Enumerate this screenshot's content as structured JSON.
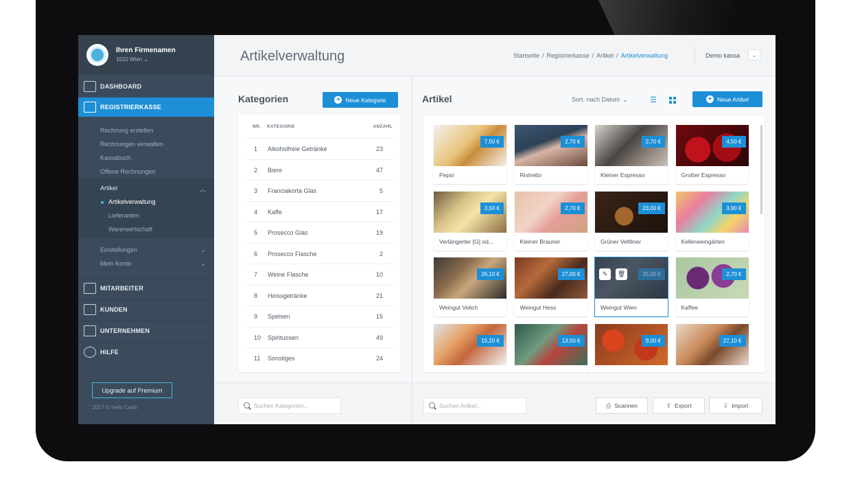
{
  "sidebar": {
    "company": "Ihren Firmenamen",
    "city": "1010 Wien",
    "main": {
      "dashboard": "DASHBOARD",
      "registrierkasse": "REGISTRIERKASSE",
      "mitarbeiter": "MITARBEITER",
      "kunden": "KUNDEN",
      "unternehmen": "UNTERNEHMEN",
      "hilfe": "HILFE"
    },
    "sub": [
      "Rechnung erstellen",
      "Rechnungen verwalten",
      "Kassabuch",
      "Offene Rechnungen"
    ],
    "artikel": "Artikel",
    "artikel_sub": [
      "Artikelverwaltung",
      "Lieferanten",
      "Warenwirtschaft"
    ],
    "einstellungen": "Einstellungen",
    "mein_konto": "Mein Konto",
    "upgrade": "Upgrade auf Premium",
    "copyright": "2017 © hello Cash"
  },
  "header": {
    "title": "Artikelverwaltung",
    "breadcrumb": [
      "Startseite",
      "/",
      "Registrierkasse",
      "/",
      "Artikel",
      "/",
      "Artikelverwaltung"
    ],
    "account": "Demo kassa"
  },
  "categories": {
    "title": "Kategorien",
    "new_button": "Neue Kategorie",
    "col_nr": "NR.",
    "col_name": "KATEGORIE",
    "col_count": "ANZAHL",
    "rows": [
      {
        "nr": "1",
        "name": "Alkoholfreie Getränke",
        "count": "23"
      },
      {
        "nr": "2",
        "name": "Biere",
        "count": "47"
      },
      {
        "nr": "3",
        "name": "Franciakorta Glas",
        "count": "5"
      },
      {
        "nr": "4",
        "name": "Kaffe",
        "count": "17"
      },
      {
        "nr": "5",
        "name": "Prosecco Glas",
        "count": "19"
      },
      {
        "nr": "6",
        "name": "Prosecco Flasche",
        "count": "2"
      },
      {
        "nr": "7",
        "name": "Weine Flasche",
        "count": "10"
      },
      {
        "nr": "8",
        "name": "Heissgetränke",
        "count": "21"
      },
      {
        "nr": "9",
        "name": "Speisen",
        "count": "15"
      },
      {
        "nr": "10",
        "name": "Spirituosen",
        "count": "49"
      },
      {
        "nr": "11",
        "name": "Sonstiges",
        "count": "24"
      }
    ],
    "search_placeholder": "Suchen Kategorien..."
  },
  "articles": {
    "title": "Artikel",
    "sort": "Sort. nach Datum",
    "new_button": "Neue Artikel",
    "search_placeholder": "Suchen Artikel...",
    "items": [
      {
        "name": "Pepsi",
        "price": "7,50 €"
      },
      {
        "name": "Ristretto",
        "price": "2,70 €"
      },
      {
        "name": "Kleiner Espresso",
        "price": "2,70 €"
      },
      {
        "name": "Großer Espresso",
        "price": "4,50 €"
      },
      {
        "name": "Verlängerter [G] od...",
        "price": "3,50 €"
      },
      {
        "name": "Kleiner Brauner",
        "price": "2,70 €"
      },
      {
        "name": "Grüner Veltliner",
        "price": "23,00 €"
      },
      {
        "name": "Kellerweingärten",
        "price": "3,90 €"
      },
      {
        "name": "Weingut Velich",
        "price": "26,10 €"
      },
      {
        "name": "Weingut Hess",
        "price": "27,00 €"
      },
      {
        "name": "Weingut Wien",
        "price": "35,00 €"
      },
      {
        "name": "Kaffee",
        "price": "2,70 €"
      },
      {
        "name": "",
        "price": "15,20 €"
      },
      {
        "name": "",
        "price": "13,50 €"
      },
      {
        "name": "",
        "price": "9,00 €"
      },
      {
        "name": "",
        "price": "27,10 €"
      }
    ],
    "scan_button": "Scannen",
    "export_button": "Export",
    "import_button": "Import"
  }
}
